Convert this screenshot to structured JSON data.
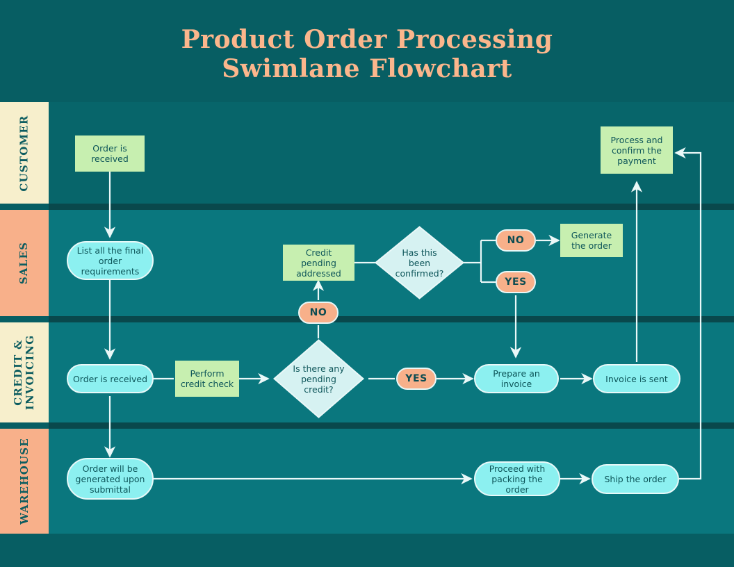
{
  "header": {
    "title_line1": "Product Order Processing",
    "title_line2": "Swimlane Flowchart",
    "title_color": "#fbb68c",
    "background": "#075e63"
  },
  "palette": {
    "page_background": "#075e63",
    "lane_dark": "#07656a",
    "lane_light": "#0a777e",
    "lane_divider": "#09484c",
    "lane_label_cream": "#f7efcc",
    "lane_label_peach": "#f8b08a",
    "lane_label_text": "#0d5d60",
    "node_green": "#c7efb0",
    "node_cyan": "#8cf0f0",
    "node_peach": "#f8b08a",
    "node_diamond": "#d6f2f2",
    "node_text": "#0d5559",
    "connector": "#eaf8f8"
  },
  "lanes": [
    {
      "label": "CUSTOMER",
      "label_bg": "#f7efcc",
      "body_bg": "#07656a"
    },
    {
      "label": "SALES",
      "label_bg": "#f8b08a",
      "body_bg": "#0a777e"
    },
    {
      "label": "CREDIT &\nINVOICING",
      "label_line1": "CREDIT &",
      "label_line2": "INVOICING",
      "label_bg": "#f7efcc",
      "body_bg": "#0a777e"
    },
    {
      "label": "WAREHOUSE",
      "label_bg": "#f8b08a",
      "body_bg": "#0a777e"
    }
  ],
  "nodes": [
    {
      "id": "order-is-received-customer",
      "lane": "CUSTOMER",
      "shape": "rect",
      "text": "Order is\nreceived",
      "line1": "Order is",
      "line2": "received"
    },
    {
      "id": "process-confirm-payment",
      "lane": "CUSTOMER",
      "shape": "rect",
      "text": "Process and confirm the payment",
      "line1": "Process and",
      "line2": "confirm the",
      "line3": "payment"
    },
    {
      "id": "list-order-requirements",
      "lane": "SALES",
      "shape": "pill",
      "text": "List all the final order requirements",
      "line1": "List all the final",
      "line2": "order requirements"
    },
    {
      "id": "credit-pending-addressed",
      "lane": "SALES",
      "shape": "rect",
      "text": "Credit pending addressed",
      "line1": "Credit pending",
      "line2": "addressed"
    },
    {
      "id": "has-this-been-confirmed",
      "lane": "SALES",
      "shape": "diamond",
      "text": "Has this been confirmed?",
      "line1": "Has this",
      "line2": "been",
      "line3": "confirmed?"
    },
    {
      "id": "confirmed-no",
      "lane": "SALES",
      "shape": "tag",
      "text": "NO"
    },
    {
      "id": "confirmed-yes",
      "lane": "SALES",
      "shape": "tag",
      "text": "YES"
    },
    {
      "id": "generate-the-order",
      "lane": "SALES",
      "shape": "rect",
      "text": "Generate the order",
      "line1": "Generate",
      "line2": "the order"
    },
    {
      "id": "credit-no",
      "lane": "SALES",
      "shape": "tag",
      "text": "NO"
    },
    {
      "id": "order-is-received-credit",
      "lane": "CREDIT & INVOICING",
      "shape": "pill",
      "text": "Order is received"
    },
    {
      "id": "perform-credit-check",
      "lane": "CREDIT & INVOICING",
      "shape": "rect",
      "text": "Perform credit check",
      "line1": "Perform",
      "line2": "credit check"
    },
    {
      "id": "is-there-pending-credit",
      "lane": "CREDIT & INVOICING",
      "shape": "diamond",
      "text": "Is there any pending credit?",
      "line1": "Is there any",
      "line2": "pending",
      "line3": "credit?"
    },
    {
      "id": "credit-yes",
      "lane": "CREDIT & INVOICING",
      "shape": "tag",
      "text": "YES"
    },
    {
      "id": "prepare-an-invoice",
      "lane": "CREDIT & INVOICING",
      "shape": "pill",
      "text": "Prepare an invoice"
    },
    {
      "id": "invoice-is-sent",
      "lane": "CREDIT & INVOICING",
      "shape": "pill",
      "text": "Invoice is sent"
    },
    {
      "id": "order-generated-submittal",
      "lane": "WAREHOUSE",
      "shape": "pill",
      "text": "Order will be generated upon submittal",
      "line1": "Order will be",
      "line2": "generated upon",
      "line3": "submittal"
    },
    {
      "id": "proceed-packing-order",
      "lane": "WAREHOUSE",
      "shape": "pill",
      "text": "Proceed with packing the order",
      "line1": "Proceed with",
      "line2": "packing the order"
    },
    {
      "id": "ship-the-order",
      "lane": "WAREHOUSE",
      "shape": "pill",
      "text": "Ship the order"
    }
  ],
  "labels": {
    "order_is_received_l1": "Order is",
    "order_is_received_l2": "received",
    "process_payment_l1": "Process and",
    "process_payment_l2": "confirm the",
    "process_payment_l3": "payment",
    "list_requirements_l1": "List all the final",
    "list_requirements_l2": "order requirements",
    "credit_pending_l1": "Credit pending",
    "credit_pending_l2": "addressed",
    "has_confirmed_l1": "Has this",
    "has_confirmed_l2": "been",
    "has_confirmed_l3": "confirmed?",
    "confirmed_no": "NO",
    "confirmed_yes": "YES",
    "generate_order_l1": "Generate",
    "generate_order_l2": "the order",
    "credit_no": "NO",
    "order_received_credit": "Order is received",
    "perform_check_l1": "Perform",
    "perform_check_l2": "credit check",
    "pending_credit_l1": "Is there any",
    "pending_credit_l2": "pending",
    "pending_credit_l3": "credit?",
    "credit_yes": "YES",
    "prepare_invoice": "Prepare an invoice",
    "invoice_sent": "Invoice is sent",
    "order_generated_l1": "Order will be",
    "order_generated_l2": "generated upon",
    "order_generated_l3": "submittal",
    "proceed_packing_l1": "Proceed with",
    "proceed_packing_l2": "packing the order",
    "ship_order": "Ship the order",
    "lane_customer": "CUSTOMER",
    "lane_sales": "SALES",
    "lane_credit_l1": "CREDIT &",
    "lane_credit_l2": "INVOICING",
    "lane_warehouse": "WAREHOUSE"
  },
  "edges": [
    {
      "from": "order-is-received-customer",
      "to": "list-order-requirements",
      "label": ""
    },
    {
      "from": "list-order-requirements",
      "to": "order-is-received-credit",
      "label": ""
    },
    {
      "from": "order-is-received-credit",
      "to": "perform-credit-check",
      "label": ""
    },
    {
      "from": "order-is-received-credit",
      "to": "order-generated-submittal",
      "label": ""
    },
    {
      "from": "perform-credit-check",
      "to": "is-there-pending-credit",
      "label": ""
    },
    {
      "from": "is-there-pending-credit",
      "to": "credit-no",
      "label": "NO"
    },
    {
      "from": "credit-no",
      "to": "credit-pending-addressed",
      "label": ""
    },
    {
      "from": "credit-pending-addressed",
      "to": "has-this-been-confirmed",
      "label": ""
    },
    {
      "from": "has-this-been-confirmed",
      "to": "confirmed-no",
      "label": "NO"
    },
    {
      "from": "has-this-been-confirmed",
      "to": "confirmed-yes",
      "label": "YES"
    },
    {
      "from": "confirmed-no",
      "to": "generate-the-order",
      "label": ""
    },
    {
      "from": "confirmed-yes",
      "to": "prepare-an-invoice",
      "label": ""
    },
    {
      "from": "is-there-pending-credit",
      "to": "credit-yes",
      "label": "YES"
    },
    {
      "from": "credit-yes",
      "to": "prepare-an-invoice",
      "label": ""
    },
    {
      "from": "prepare-an-invoice",
      "to": "invoice-is-sent",
      "label": ""
    },
    {
      "from": "invoice-is-sent",
      "to": "process-confirm-payment",
      "label": ""
    },
    {
      "from": "order-generated-submittal",
      "to": "proceed-packing-order",
      "label": ""
    },
    {
      "from": "proceed-packing-order",
      "to": "ship-the-order",
      "label": ""
    },
    {
      "from": "ship-the-order",
      "to": "process-confirm-payment",
      "label": ""
    }
  ]
}
